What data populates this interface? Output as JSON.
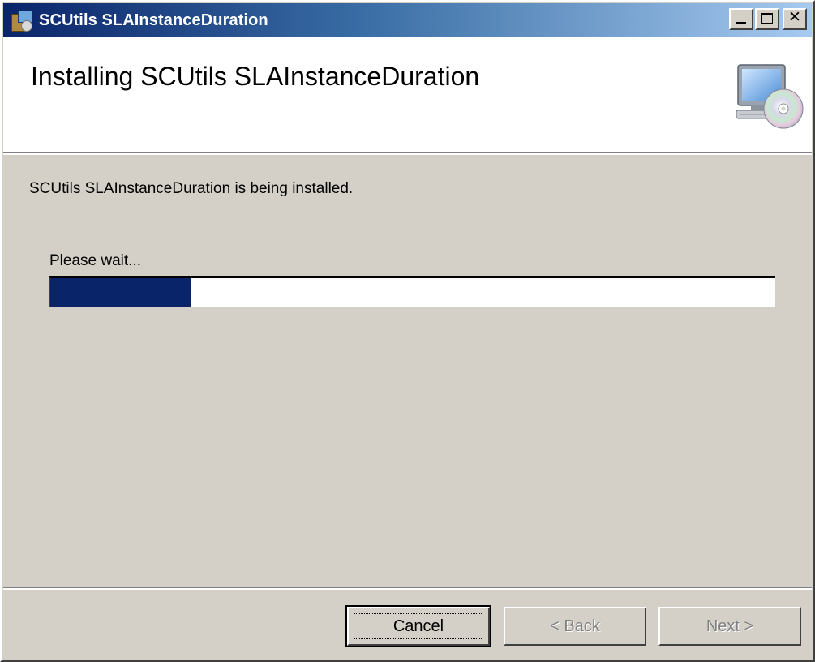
{
  "window": {
    "title": "SCUtils SLAInstanceDuration",
    "controls": {
      "minimize_icon": "minimize-icon",
      "maximize_icon": "maximize-icon",
      "close_glyph": "✕"
    }
  },
  "banner": {
    "title": "Installing SCUtils SLAInstanceDuration",
    "icon": "computer-cd-icon"
  },
  "body": {
    "status_text": "SCUtils SLAInstanceDuration is being installed.",
    "wait_label": "Please wait...",
    "progress_fraction": 0.193,
    "progress_color": "#0a246a"
  },
  "buttons": {
    "cancel": "Cancel",
    "back": "< Back",
    "next": "Next >"
  },
  "colors": {
    "dialog_bg": "#d4d0c8",
    "titlebar_start": "#0a246a",
    "titlebar_end": "#a6caf0"
  }
}
